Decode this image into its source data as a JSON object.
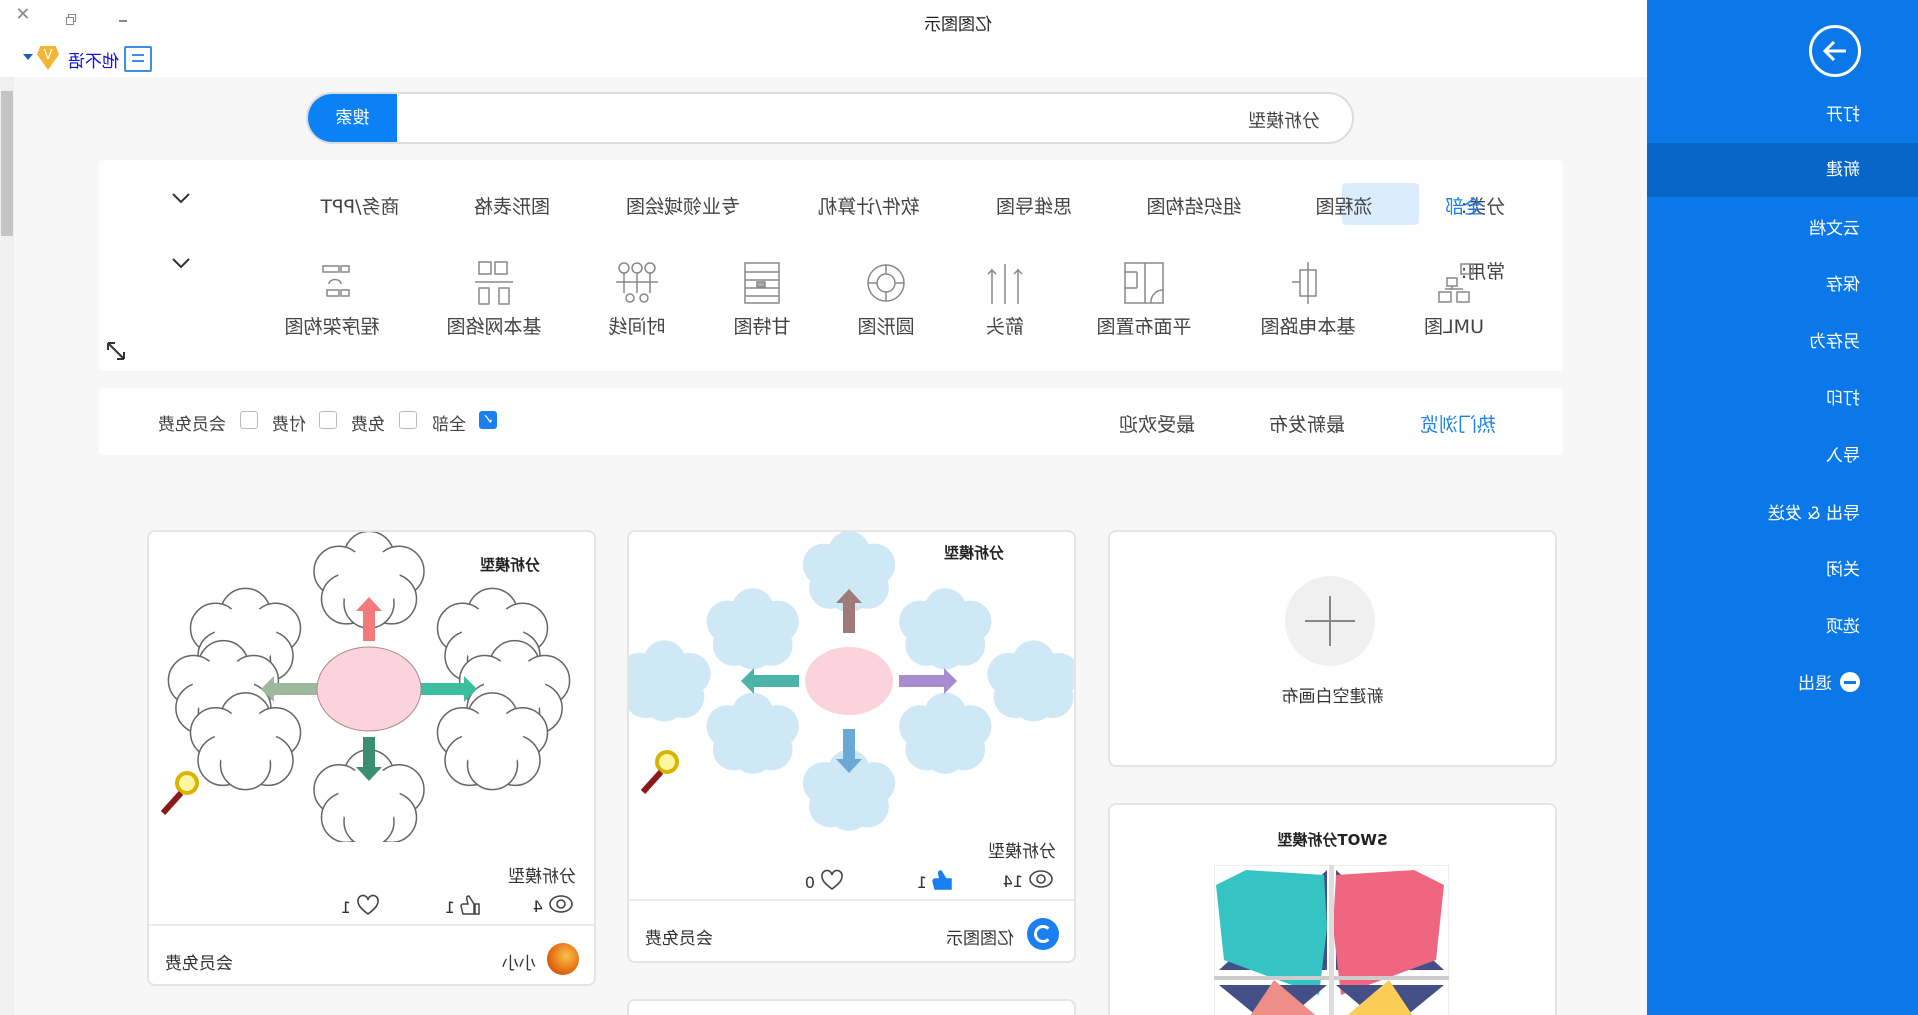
{
  "window": {
    "title": "亿图图示",
    "user": "他不语"
  },
  "sidebar": {
    "items": [
      {
        "label": "打开"
      },
      {
        "label": "新建",
        "active": true
      },
      {
        "label": "云文档"
      },
      {
        "label": "保存"
      },
      {
        "label": "另存为"
      },
      {
        "label": "打印"
      },
      {
        "label": "导入"
      },
      {
        "label": "导出 & 发送"
      },
      {
        "label": "关闭"
      },
      {
        "label": "选项"
      },
      {
        "label": "退出"
      }
    ]
  },
  "search": {
    "button": "搜索",
    "value": "分析模型"
  },
  "categories": {
    "label": "分类:",
    "items": [
      "全部",
      "流程图",
      "组织结构图",
      "思维导图",
      "软件/计算机",
      "专业领域绘图",
      "图形表格",
      "商务/PPT"
    ],
    "selected": "全部"
  },
  "common": {
    "label": "常用:",
    "items": [
      "UML图",
      "基本电路图",
      "平面布置图",
      "箭头",
      "圆形图",
      "甘特图",
      "时间线",
      "基本网络图",
      "程序架构图"
    ]
  },
  "sort": {
    "tabs": [
      "热门浏览",
      "最新发布",
      "最受欢迎"
    ],
    "active": "热门浏览"
  },
  "filters": [
    {
      "label": "全部",
      "checked": true
    },
    {
      "label": "免费",
      "checked": false
    },
    {
      "label": "付费",
      "checked": false
    },
    {
      "label": "会员免费",
      "checked": false
    }
  ],
  "cards": [
    {
      "preview_title": "分析模型",
      "title": "分析模型",
      "views": "4",
      "likes": "1",
      "favorites": "1",
      "author": "小小",
      "price": "会员免费"
    },
    {
      "preview_title": "分析模型",
      "title": "分析模型",
      "views": "14",
      "likes": "1",
      "favorites": "0",
      "author": "亿图图示",
      "price": "会员免费"
    }
  ],
  "blank_card": {
    "label": "新建空白画布"
  },
  "swot_card": {
    "preview_title": "SWOT分析模型"
  },
  "colors": {
    "sidebar": "#0a78e8",
    "sidebar_active": "#0966c9",
    "accent": "#1a7ff0",
    "selected_bg": "#dcecff"
  }
}
